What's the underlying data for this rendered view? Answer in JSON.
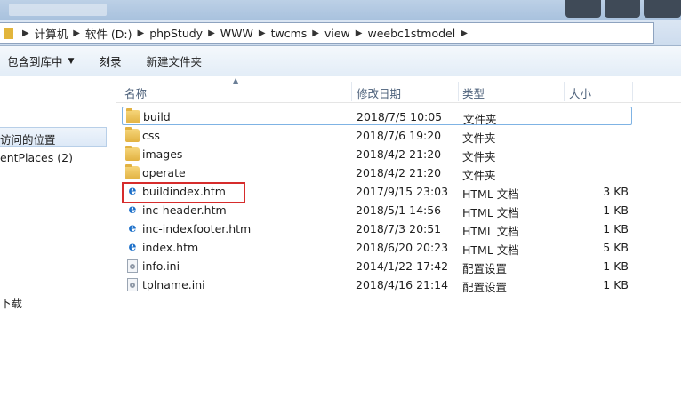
{
  "address_bar": {
    "crumbs": [
      "计算机",
      "软件 (D:)",
      "phpStudy",
      "WWW",
      "twcms",
      "view",
      "weebc1stmodel"
    ]
  },
  "toolbar": {
    "include_library": "包含到库中",
    "burn": "刻录",
    "new_folder": "新建文件夹"
  },
  "nav": {
    "recent_places": "访问的位置",
    "recent_places_en": "entPlaces (2)",
    "downloads": "下载"
  },
  "columns": {
    "name": "名称",
    "modified": "修改日期",
    "type": "类型",
    "size": "大小"
  },
  "files": [
    {
      "name": "build",
      "date": "2018/7/5 10:05",
      "type": "文件夹",
      "size": "",
      "icon": "folder-icon"
    },
    {
      "name": "css",
      "date": "2018/7/6 19:20",
      "type": "文件夹",
      "size": "",
      "icon": "folder-icon"
    },
    {
      "name": "images",
      "date": "2018/4/2 21:20",
      "type": "文件夹",
      "size": "",
      "icon": "folder-icon"
    },
    {
      "name": "operate",
      "date": "2018/4/2 21:20",
      "type": "文件夹",
      "size": "",
      "icon": "folder-icon"
    },
    {
      "name": "buildindex.htm",
      "date": "2017/9/15 23:03",
      "type": "HTML 文档",
      "size": "3 KB",
      "icon": "ie-html-icon"
    },
    {
      "name": "inc-header.htm",
      "date": "2018/5/1 14:56",
      "type": "HTML 文档",
      "size": "1 KB",
      "icon": "ie-html-icon"
    },
    {
      "name": "inc-indexfooter.htm",
      "date": "2018/7/3 20:51",
      "type": "HTML 文档",
      "size": "1 KB",
      "icon": "ie-html-icon"
    },
    {
      "name": "index.htm",
      "date": "2018/6/20 20:23",
      "type": "HTML 文档",
      "size": "5 KB",
      "icon": "ie-html-icon"
    },
    {
      "name": "info.ini",
      "date": "2014/1/22 17:42",
      "type": "配置设置",
      "size": "1 KB",
      "icon": "ini-settings-icon"
    },
    {
      "name": "tplname.ini",
      "date": "2018/4/16 21:14",
      "type": "配置设置",
      "size": "1 KB",
      "icon": "ini-settings-icon"
    }
  ],
  "colors": {
    "highlight_box": "#d62c2c",
    "selection_border": "#7fb3e4",
    "folder": "#e2b241"
  }
}
